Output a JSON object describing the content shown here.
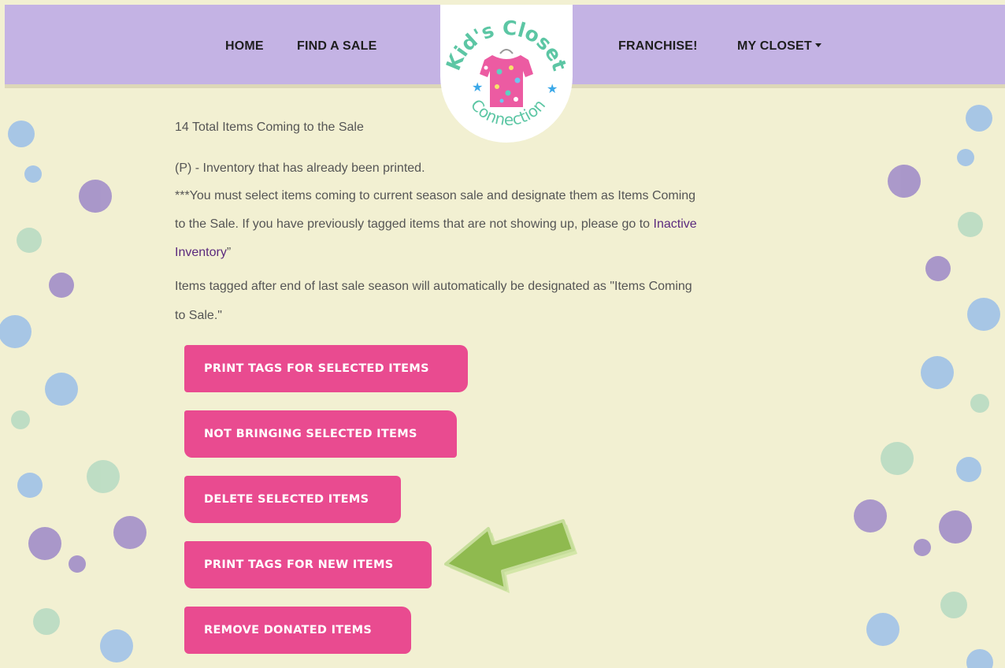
{
  "nav": {
    "left_links": [
      "HOME",
      "FIND A SALE"
    ],
    "right_links": [
      "FRANCHISE!",
      "MY CLOSET"
    ]
  },
  "logo": {
    "text_top": "Kid's Closet",
    "text_bottom": "Connection",
    "icon": "polka-dot-shirt-icon"
  },
  "content": {
    "total_items": "14 Total Items Coming to the Sale",
    "printed_note": "(P) - Inventory that has already been printed.",
    "instructions_line1": "***You must select items coming to current season sale and designate them as Items Coming",
    "instructions_line2": "to the Sale. If you have previously tagged items that are not showing up, please go to ",
    "inactive_link_word1": "Inactive",
    "inactive_link_word2": "Inventory",
    "instructions_end": "”",
    "auto_note_line1": "Items tagged after end of last sale season will automatically be designated as \"Items Coming",
    "auto_note_line2": "to Sale.\""
  },
  "buttons": {
    "print_selected": "PRINT TAGS FOR SELECTED ITEMS",
    "not_bringing": "NOT BRINGING SELECTED ITEMS",
    "delete_selected": "DELETE SELECTED ITEMS",
    "print_new": "PRINT TAGS FOR NEW ITEMS",
    "remove_donated": "REMOVE DONATED ITEMS"
  },
  "colors": {
    "nav_bg": "#c4b3e4",
    "page_bg": "#f2f0d2",
    "button_bg": "#e94b90",
    "link": "#5b2a7e",
    "arrow": "#8fba4f",
    "bubble_blue": "#a4c4e7",
    "bubble_purple": "#a693c9",
    "bubble_green": "#bcdcc4"
  }
}
